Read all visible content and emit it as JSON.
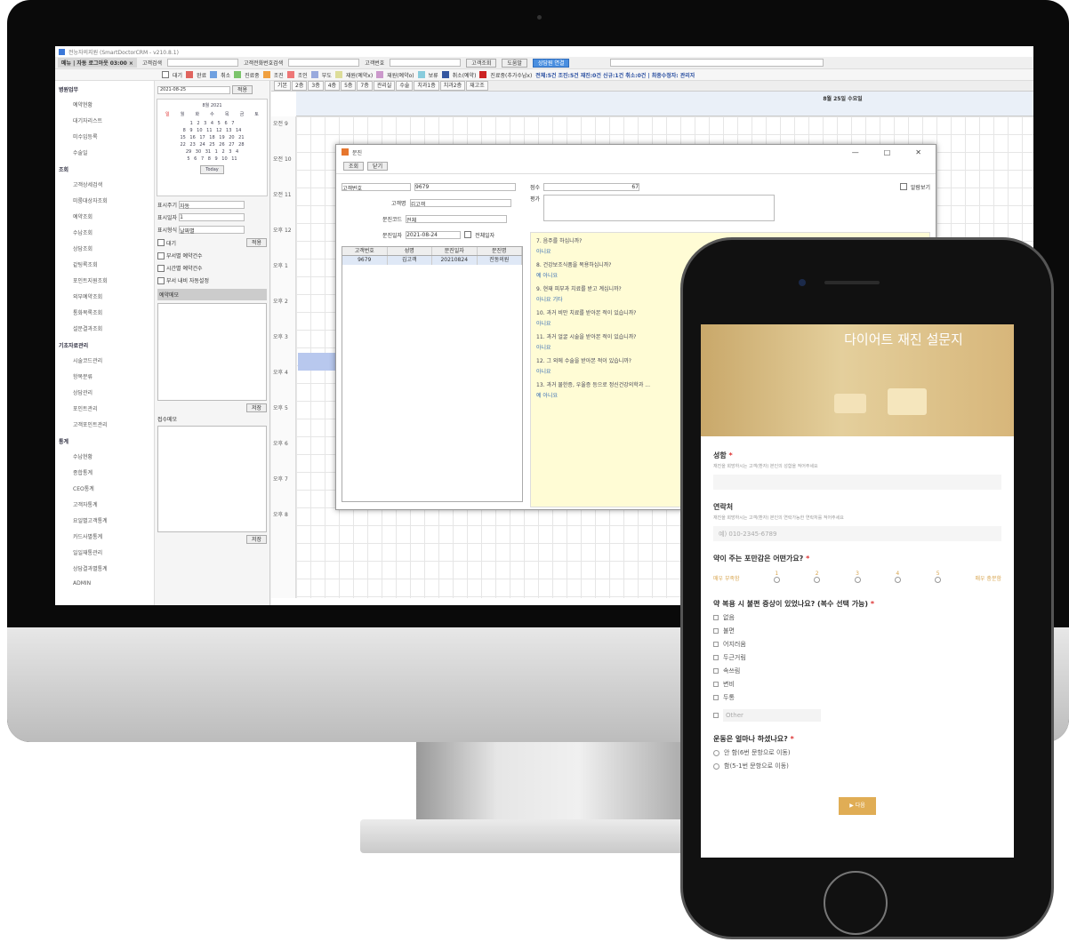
{
  "app": {
    "title": "전능자의지원 (SmartDoctorCRM - v210.8.1)",
    "tab": "메뉴 | 자동 로그아웃 03:00 ×"
  },
  "search": {
    "customer_label": "고객검색",
    "phone_label": "고객전화번호검색",
    "number_label": "고객번호",
    "search_btn": "고객조회",
    "help_btn": "도움말",
    "consult_btn": "상담원 연결"
  },
  "legend": [
    "대기",
    "완료",
    "취소",
    "진료중",
    "조진",
    "조인",
    "부도",
    "재원(예약x)",
    "재원(예약o)",
    "보류",
    "취소(예약)",
    "진료중(추가수납x)"
  ],
  "status_summary": "전체:5건 조진:5건 재진:0건 신규:1건 취소:0건 | 최종수정자: 관리자",
  "sidebar": {
    "sections": [
      {
        "title": "병원업무",
        "items": [
          "예약현황",
          "대기자리스트",
          "미수입등록",
          "수술일"
        ]
      },
      {
        "title": "조회",
        "items": [
          "고객상세검색",
          "미룸대상자조회",
          "예약조회",
          "수납조회",
          "상담조회",
          "같팅록조회",
          "포인트지원조회",
          "외부예약조회",
          "통화목록조회",
          "설문결과조회"
        ]
      },
      {
        "title": "기초자료관리",
        "items": [
          "시술코드관리",
          "항목분류",
          "상담관리",
          "포인트관리",
          "고객포인트관리"
        ]
      },
      {
        "title": "통계",
        "items": [
          "수납현황",
          "종합통계",
          "CEO통계",
          "고객자통계",
          "요일별고객통계",
          "카드사별통계",
          "일일재통관리",
          "상담결과별통계",
          "ADMIN"
        ]
      }
    ]
  },
  "calendar": {
    "date": "2021-08-25",
    "apply_btn": "적용",
    "month": "8월",
    "year": "2021",
    "days": [
      "일",
      "월",
      "화",
      "수",
      "목",
      "금",
      "토"
    ],
    "weeks": [
      "1 2 3 4 5 6 7",
      "8 9 10 11 12 13 14",
      "15 16 17 18 19 20 21",
      "22 23 24 25 26 27 28",
      "29 30 31 1 2 3 4",
      "5 6 7 8 9 10 11"
    ],
    "today_btn": "Today"
  },
  "display": {
    "period_label": "표시주기",
    "period_val": "자동",
    "date_label": "표시일자",
    "date_val": "1",
    "format_label": "표시형식",
    "format_val": "날짜별",
    "wait_label": "대기",
    "checks": [
      "부서별 예약건수",
      "시간별 예약건수",
      "부서 내비 자동설정"
    ],
    "memo_label": "예약메모",
    "save_btn": "저장",
    "reception_label": "접수메모"
  },
  "grid": {
    "tabs": [
      "기본",
      "2층",
      "3층",
      "4층",
      "5층",
      "7층",
      "관리실",
      "수술",
      "치과1층",
      "치과2층",
      "재고조"
    ],
    "day_header": "8월 25일 수요일",
    "times": [
      "오전 9",
      "오전 10",
      "오전 11",
      "오후 12",
      "오후 1",
      "오후 2",
      "오후 3",
      "오후 4",
      "오후 5",
      "오후 6",
      "오후 7",
      "오후 8"
    ],
    "half": "30"
  },
  "dialog": {
    "title": "문진",
    "btn_view": "조회",
    "btn_close": "닫기",
    "cust_label": "고객번호",
    "cust_val": "9679",
    "name_label": "고객명",
    "name_val": "김고객",
    "code_label": "문진코드",
    "code_val": "전체",
    "date_label": "문진일자",
    "date_val": "2021-08-24",
    "all_dates": "전체일자",
    "cols": [
      "고객번호",
      "성명",
      "문진일자",
      "문진명"
    ],
    "row": [
      "9679",
      "김고객",
      "20210824",
      "진동의원"
    ],
    "score_label": "점수",
    "score_val": "67",
    "eval_label": "평가",
    "auto_label": "알람보기",
    "questions": [
      {
        "q": "7. 음주를 하십니까?",
        "a": "아니요"
      },
      {
        "q": "8. 건강보조식품을 복용하십니까?",
        "a": "예  아니요"
      },
      {
        "q": "9. 현재 피부과 치료를 받고 계십니까?",
        "a": "아니요  기타"
      },
      {
        "q": "10. 과거 비만 치료를 받아본 적이 있습니까?",
        "a": "아니요"
      },
      {
        "q": "11. 과거 얼굴 시술을 받아본 적이 있습니까?",
        "a": "아니요"
      },
      {
        "q": "12. 그 외에 수술을 받아본 적이 있습니까?",
        "a": "아니요"
      },
      {
        "q": "13. 과거 물한증, 우울증 등으로 정신건강의학과 ...",
        "a": "예  아니요"
      }
    ]
  },
  "mobile": {
    "title": "다이어트 재진 설문지",
    "q_name": "성함",
    "q_name_desc": "재진을 희망하시는 고객(환자) 본인의 성함을 적어주세요",
    "q_phone": "연락처",
    "q_phone_desc": "재진을 희망하시는 고객(환자) 본인의 연락가능한 연락처를 적어주세요",
    "phone_ph": "예) 010-2345-6789",
    "q_full": "약이 주는 포만감은 어떤가요?",
    "scale_low": "매우 부족함",
    "scale_high": "매우 충분함",
    "scale_nums": [
      "1",
      "2",
      "3",
      "4",
      "5"
    ],
    "q_side": "약 복용 시 불편 증상이 있었나요? (복수 선택 가능)",
    "side_opts": [
      "없음",
      "불면",
      "어지러움",
      "두근거림",
      "속쓰림",
      "변비",
      "두통"
    ],
    "other": "Other",
    "q_ex": "운동은 얼마나 하셨나요?",
    "ex_opts": [
      "안 함(6번 문항으로 이동)",
      "함(5-1번 문항으로 이동)"
    ],
    "next_btn": "다음"
  }
}
